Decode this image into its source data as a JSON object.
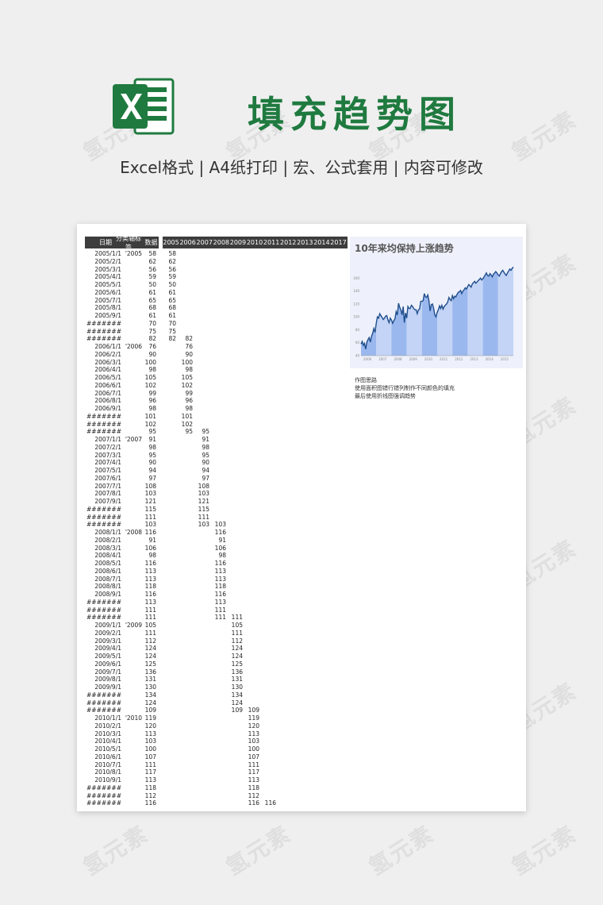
{
  "header": {
    "title": "填充趋势图",
    "subtitle": "Excel格式 |  A4纸打印 | 宏、公式套用 | 内容可修改",
    "logo_icon": "excel-logo-icon",
    "brand_color": "#1f7a3f"
  },
  "watermark": "氢元素",
  "sheet": {
    "columns": [
      "日期",
      "分类轴标签",
      "数据"
    ],
    "years": [
      "2005",
      "2006",
      "2007",
      "2008",
      "2009",
      "2010",
      "2011",
      "2012",
      "2013",
      "2014",
      "2017"
    ],
    "rows": [
      [
        "2005/1/1",
        "'2005",
        "58"
      ],
      [
        "2005/2/1",
        "",
        "62"
      ],
      [
        "2005/3/1",
        "",
        "56"
      ],
      [
        "2005/4/1",
        "",
        "59"
      ],
      [
        "2005/5/1",
        "",
        "50"
      ],
      [
        "2005/6/1",
        "",
        "61"
      ],
      [
        "2005/7/1",
        "",
        "65"
      ],
      [
        "2005/8/1",
        "",
        "68"
      ],
      [
        "2005/9/1",
        "",
        "61"
      ],
      [
        "#######",
        "",
        "70"
      ],
      [
        "#######",
        "",
        "75"
      ],
      [
        "#######",
        "",
        "82"
      ],
      [
        "2006/1/1",
        "'2006",
        "76"
      ],
      [
        "2006/2/1",
        "",
        "90"
      ],
      [
        "2006/3/1",
        "",
        "100"
      ],
      [
        "2006/4/1",
        "",
        "98"
      ],
      [
        "2006/5/1",
        "",
        "105"
      ],
      [
        "2006/6/1",
        "",
        "102"
      ],
      [
        "2006/7/1",
        "",
        "99"
      ],
      [
        "2006/8/1",
        "",
        "96"
      ],
      [
        "2006/9/1",
        "",
        "98"
      ],
      [
        "#######",
        "",
        "101"
      ],
      [
        "#######",
        "",
        "102"
      ],
      [
        "#######",
        "",
        "95"
      ],
      [
        "2007/1/1",
        "'2007",
        "91"
      ],
      [
        "2007/2/1",
        "",
        "98"
      ],
      [
        "2007/3/1",
        "",
        "95"
      ],
      [
        "2007/4/1",
        "",
        "90"
      ],
      [
        "2007/5/1",
        "",
        "94"
      ],
      [
        "2007/6/1",
        "",
        "97"
      ],
      [
        "2007/7/1",
        "",
        "108"
      ],
      [
        "2007/8/1",
        "",
        "103"
      ],
      [
        "2007/9/1",
        "",
        "121"
      ],
      [
        "#######",
        "",
        "115"
      ],
      [
        "#######",
        "",
        "111"
      ],
      [
        "#######",
        "",
        "103"
      ],
      [
        "2008/1/1",
        "'2008",
        "116"
      ],
      [
        "2008/2/1",
        "",
        "91"
      ],
      [
        "2008/3/1",
        "",
        "106"
      ],
      [
        "2008/4/1",
        "",
        "98"
      ],
      [
        "2008/5/1",
        "",
        "116"
      ],
      [
        "2008/6/1",
        "",
        "113"
      ],
      [
        "2008/7/1",
        "",
        "113"
      ],
      [
        "2008/8/1",
        "",
        "118"
      ],
      [
        "2008/9/1",
        "",
        "116"
      ],
      [
        "#######",
        "",
        "113"
      ],
      [
        "#######",
        "",
        "111"
      ],
      [
        "#######",
        "",
        "111"
      ],
      [
        "2009/1/1",
        "'2009",
        "105"
      ],
      [
        "2009/2/1",
        "",
        "111"
      ],
      [
        "2009/3/1",
        "",
        "112"
      ],
      [
        "2009/4/1",
        "",
        "124"
      ],
      [
        "2009/5/1",
        "",
        "124"
      ],
      [
        "2009/6/1",
        "",
        "125"
      ],
      [
        "2009/7/1",
        "",
        "136"
      ],
      [
        "2009/8/1",
        "",
        "131"
      ],
      [
        "2009/9/1",
        "",
        "130"
      ],
      [
        "#######",
        "",
        "134"
      ],
      [
        "#######",
        "",
        "124"
      ],
      [
        "#######",
        "",
        "109"
      ],
      [
        "2010/1/1",
        "'2010",
        "119"
      ],
      [
        "2010/2/1",
        "",
        "120"
      ],
      [
        "2010/3/1",
        "",
        "113"
      ],
      [
        "2010/4/1",
        "",
        "103"
      ],
      [
        "2010/5/1",
        "",
        "100"
      ],
      [
        "2010/6/1",
        "",
        "107"
      ],
      [
        "2010/7/1",
        "",
        "111"
      ],
      [
        "2010/8/1",
        "",
        "117"
      ],
      [
        "2010/9/1",
        "",
        "113"
      ],
      [
        "#######",
        "",
        "118"
      ],
      [
        "#######",
        "",
        "112"
      ],
      [
        "#######",
        "",
        "116"
      ]
    ],
    "extra_cells": [
      "82",
      "95",
      "103",
      "111",
      "109",
      "116"
    ]
  },
  "chart_data": {
    "type": "area",
    "title": "10年来均保持上涨趋势",
    "subtitle": "",
    "x": [
      "2006",
      "2007",
      "2008",
      "2009",
      "2010",
      "2011",
      "2012",
      "2013",
      "2014",
      "2015"
    ],
    "series": [
      {
        "values": [
          58,
          62,
          56,
          59,
          50,
          61,
          65,
          68,
          61,
          70,
          75,
          82,
          76,
          90,
          100,
          98,
          105,
          102,
          99,
          96,
          98,
          101,
          102,
          95,
          91,
          98,
          95,
          90,
          94,
          97,
          108,
          103,
          121,
          115,
          111,
          103,
          116,
          91,
          106,
          98,
          116,
          113,
          113,
          118,
          116,
          113,
          111,
          111,
          105,
          111,
          112,
          124,
          124,
          125,
          136,
          131,
          130,
          134,
          124,
          109,
          119,
          120,
          113,
          103,
          100,
          107,
          111,
          117,
          113,
          118,
          112,
          116,
          118,
          120,
          123,
          130,
          127,
          125,
          133,
          128,
          132,
          131,
          135,
          138,
          139,
          141,
          136,
          140,
          142,
          145,
          143,
          147,
          150,
          148,
          146,
          151,
          153,
          155,
          152,
          154,
          156,
          158,
          160,
          157,
          159,
          162,
          165,
          168,
          164,
          163,
          167,
          165,
          162,
          166,
          168,
          170,
          168,
          165,
          163,
          167,
          170,
          172,
          169,
          166,
          164,
          168,
          171,
          174,
          172,
          175,
          177
        ]
      }
    ],
    "yticks": [
      "40",
      "60",
      "80",
      "100",
      "120",
      "140",
      "160"
    ],
    "ylim": [
      40,
      180
    ],
    "colors": {
      "line": "#1f4e8c",
      "band_dark": "#9bb8ee",
      "band_light": "#c4d4f6",
      "bg": "#eef1fb"
    }
  },
  "notes": {
    "heading": "作图思路",
    "line1": "使用面积图错行错列制作不同颜色的填充",
    "line2": "最后使用折线图强调趋势"
  }
}
